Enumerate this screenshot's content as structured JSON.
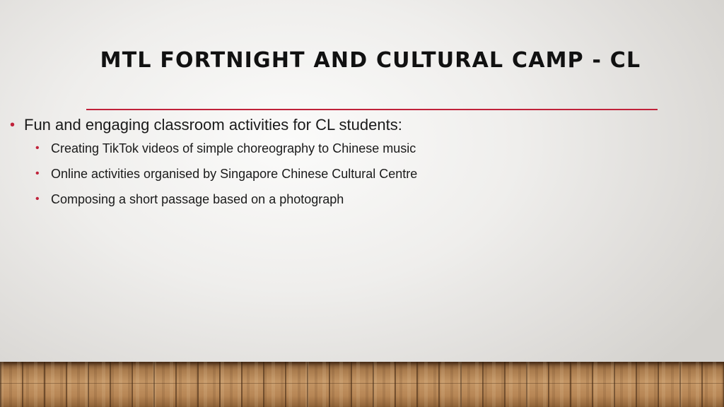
{
  "slide": {
    "title": "MTL FORTNIGHT AND CULTURAL CAMP - CL",
    "accent_color": "#c0223a",
    "bullets": [
      {
        "text": "Fun and engaging classroom activities for CL students:",
        "sub_bullets": [
          "Creating TikTok videos of simple choreography to Chinese music",
          "Online activities organised by Singapore Chinese Cultural Centre",
          "Composing a short passage based on a photograph"
        ]
      }
    ]
  }
}
